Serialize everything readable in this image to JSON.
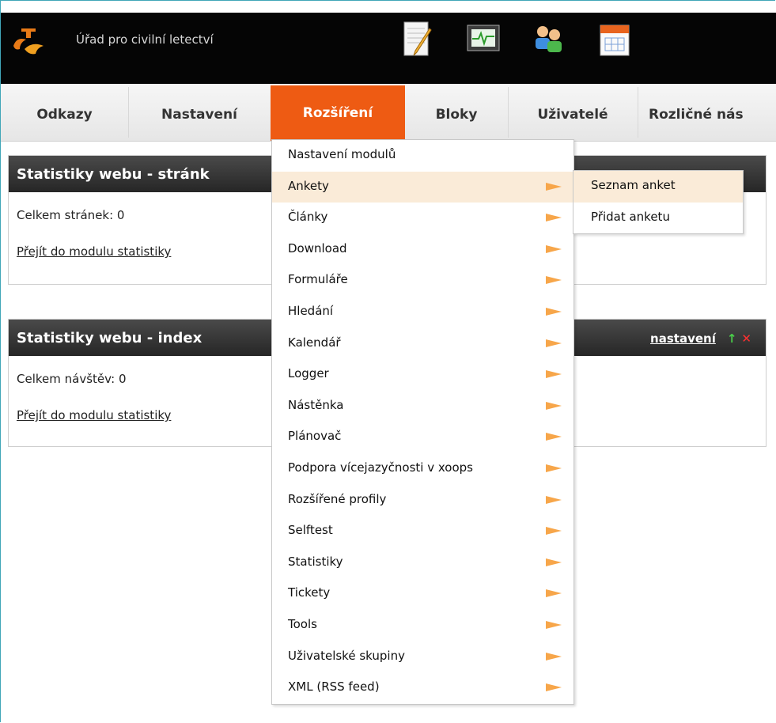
{
  "header": {
    "site_title": "Úřad pro civilní letectví",
    "tools": [
      "edit-notepad-icon",
      "monitor-icon",
      "users-icon",
      "calendar-icon"
    ]
  },
  "nav": {
    "items": [
      "Odkazy",
      "Nastavení",
      "Rozšíření",
      "Bloky",
      "Uživatelé",
      "Rozličné nás"
    ],
    "active": "Rozšíření"
  },
  "panels": [
    {
      "title": "Statistiky webu - stránk",
      "line": "Celkem stránek: 0",
      "link": "Přejít do modulu statistiky"
    },
    {
      "title": "Statistiky webu - index",
      "line": "Celkem návštěv: 0",
      "link": "Přejít do modulu statistiky",
      "settings_link": "nastavení"
    }
  ],
  "menu": {
    "items": [
      "Nastavení modulů",
      "Ankety",
      "Články",
      "Download",
      "Formuláře",
      "Hledání",
      "Kalendář",
      "Logger",
      "Nástěnka",
      "Plánovač",
      "Podpora vícejazyčnosti v xoops",
      "Rozšířené profily",
      "Selftest",
      "Statistiky",
      "Tickety",
      "Tools",
      "Uživatelské skupiny",
      "XML (RSS feed)"
    ],
    "hovered": "Ankety"
  },
  "submenu": {
    "items": [
      "Seznam anket",
      "Přidat anketu"
    ],
    "hovered": "Seznam anket"
  },
  "colors": {
    "accent": "#ee5b13",
    "header_bg": "#050505",
    "menu_hover": "#faebd8",
    "menu_arrow": "#f7a64a"
  }
}
